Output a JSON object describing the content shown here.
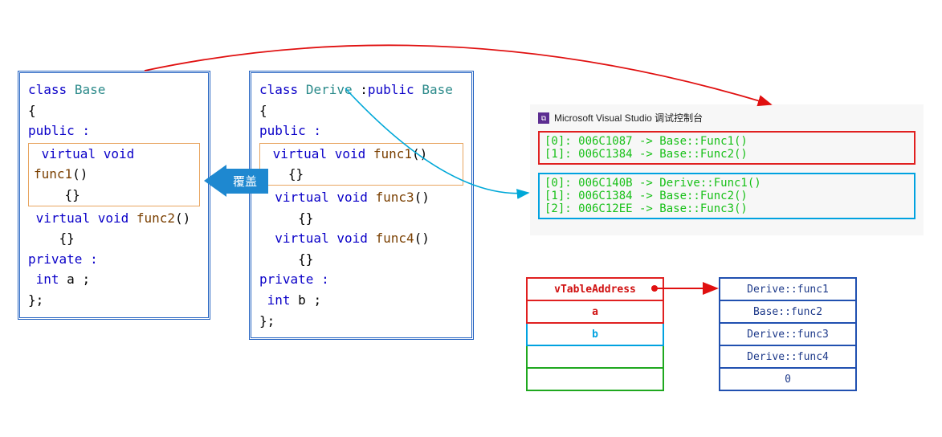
{
  "base_class": {
    "decl": "class Base",
    "open": "{",
    "public": "public :",
    "func1_sig": "virtual void func1()",
    "func1_body": "{}",
    "func2_sig": "virtual void func2()",
    "func2_body": "{}",
    "private": "private :",
    "member": "int a ;",
    "close": "};"
  },
  "derive_class": {
    "decl": "class Derive :public Base",
    "open": "{",
    "public": "public :",
    "func1_sig": "virtual void func1()",
    "func1_body": "{}",
    "func3_sig": "virtual void func3()",
    "func3_body": "{}",
    "func4_sig": "virtual void func4()",
    "func4_body": "{}",
    "private": "private :",
    "member": "int b ;",
    "close": "};"
  },
  "override_label": "覆盖",
  "console": {
    "title": "Microsoft Visual Studio 调试控制台",
    "base_vtable": [
      "[0]: 006C1087 -> Base::Func1()",
      "[1]: 006C1384 -> Base::Func2()"
    ],
    "derive_vtable": [
      "[0]: 006C140B -> Derive::Func1()",
      "[1]: 006C1384 -> Base::Func2()",
      "[2]: 006C12EE -> Base::Func3()"
    ]
  },
  "memory_layout": {
    "rows": [
      {
        "label": "vTableAddress",
        "style": "red"
      },
      {
        "label": "a",
        "style": "red"
      },
      {
        "label": "b",
        "style": "blue"
      },
      {
        "label": "",
        "style": "green"
      },
      {
        "label": "",
        "style": "green"
      }
    ]
  },
  "vtable_entries": [
    "Derive::func1",
    "Base::func2",
    "Derive::func3",
    "Derive::func4",
    "0"
  ]
}
